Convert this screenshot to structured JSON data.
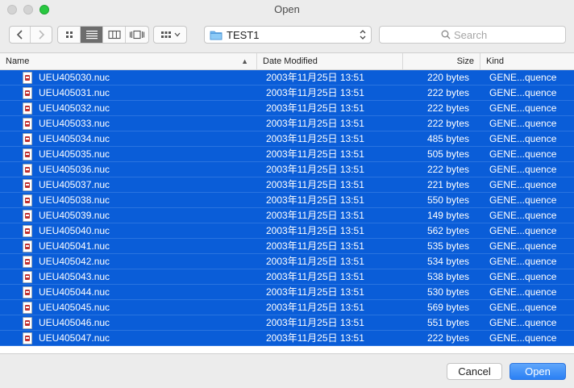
{
  "window": {
    "title": "Open"
  },
  "toolbar": {
    "back_icon": "chevron-left-icon",
    "forward_icon": "chevron-right-icon",
    "views": [
      "icon-view",
      "list-view",
      "column-view",
      "cover-flow-view"
    ],
    "active_view": "list-view",
    "arrange_icon": "arrange-grid-icon",
    "folder": "TEST1",
    "search_placeholder": "Search"
  },
  "columns": {
    "name": "Name",
    "date": "Date Modified",
    "size": "Size",
    "kind": "Kind"
  },
  "sort": {
    "column": "name",
    "direction": "ascending"
  },
  "files": [
    {
      "name": "UEU405030.nuc",
      "date": "2003年11月25日 13:51",
      "size": "220 bytes",
      "kind": "GENE...quence"
    },
    {
      "name": "UEU405031.nuc",
      "date": "2003年11月25日 13:51",
      "size": "222 bytes",
      "kind": "GENE...quence"
    },
    {
      "name": "UEU405032.nuc",
      "date": "2003年11月25日 13:51",
      "size": "222 bytes",
      "kind": "GENE...quence"
    },
    {
      "name": "UEU405033.nuc",
      "date": "2003年11月25日 13:51",
      "size": "222 bytes",
      "kind": "GENE...quence"
    },
    {
      "name": "UEU405034.nuc",
      "date": "2003年11月25日 13:51",
      "size": "485 bytes",
      "kind": "GENE...quence"
    },
    {
      "name": "UEU405035.nuc",
      "date": "2003年11月25日 13:51",
      "size": "505 bytes",
      "kind": "GENE...quence"
    },
    {
      "name": "UEU405036.nuc",
      "date": "2003年11月25日 13:51",
      "size": "222 bytes",
      "kind": "GENE...quence"
    },
    {
      "name": "UEU405037.nuc",
      "date": "2003年11月25日 13:51",
      "size": "221 bytes",
      "kind": "GENE...quence"
    },
    {
      "name": "UEU405038.nuc",
      "date": "2003年11月25日 13:51",
      "size": "550 bytes",
      "kind": "GENE...quence"
    },
    {
      "name": "UEU405039.nuc",
      "date": "2003年11月25日 13:51",
      "size": "149 bytes",
      "kind": "GENE...quence"
    },
    {
      "name": "UEU405040.nuc",
      "date": "2003年11月25日 13:51",
      "size": "562 bytes",
      "kind": "GENE...quence"
    },
    {
      "name": "UEU405041.nuc",
      "date": "2003年11月25日 13:51",
      "size": "535 bytes",
      "kind": "GENE...quence"
    },
    {
      "name": "UEU405042.nuc",
      "date": "2003年11月25日 13:51",
      "size": "534 bytes",
      "kind": "GENE...quence"
    },
    {
      "name": "UEU405043.nuc",
      "date": "2003年11月25日 13:51",
      "size": "538 bytes",
      "kind": "GENE...quence"
    },
    {
      "name": "UEU405044.nuc",
      "date": "2003年11月25日 13:51",
      "size": "530 bytes",
      "kind": "GENE...quence"
    },
    {
      "name": "UEU405045.nuc",
      "date": "2003年11月25日 13:51",
      "size": "569 bytes",
      "kind": "GENE...quence"
    },
    {
      "name": "UEU405046.nuc",
      "date": "2003年11月25日 13:51",
      "size": "551 bytes",
      "kind": "GENE...quence"
    },
    {
      "name": "UEU405047.nuc",
      "date": "2003年11月25日 13:51",
      "size": "222 bytes",
      "kind": "GENE...quence"
    }
  ],
  "buttons": {
    "cancel": "Cancel",
    "open": "Open"
  },
  "colors": {
    "selection": "#0a5dd8",
    "default_button": "#2a80f4"
  }
}
